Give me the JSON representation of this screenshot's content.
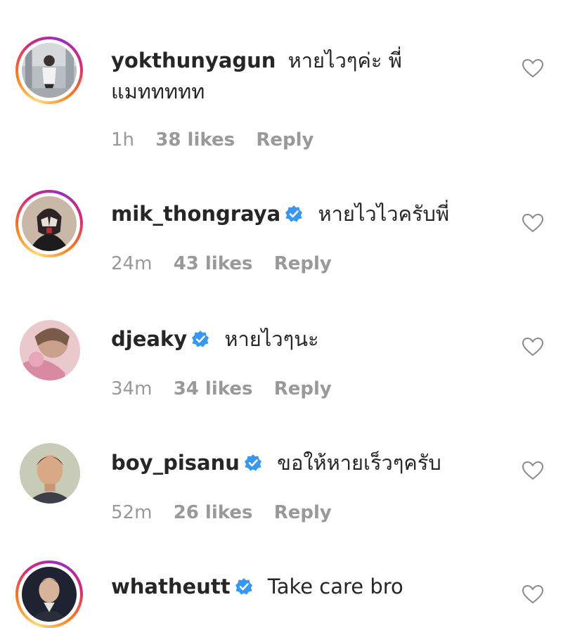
{
  "comments": [
    {
      "username": "yokthunyagun",
      "verified": false,
      "message": "หายไวๆค่ะ พี่แมททททท",
      "time": "1h",
      "likes": "38 likes",
      "reply": "Reply",
      "avatar_icon": "avatar-photo",
      "has_story_ring": true
    },
    {
      "username": "mik_thongraya",
      "verified": true,
      "message": "หายไวไวครับพี่",
      "time": "24m",
      "likes": "43 likes",
      "reply": "Reply",
      "avatar_icon": "avatar-photo",
      "has_story_ring": true
    },
    {
      "username": "djeaky",
      "verified": true,
      "message": "หายไวๆนะ",
      "time": "34m",
      "likes": "34 likes",
      "reply": "Reply",
      "avatar_icon": "avatar-photo",
      "has_story_ring": false
    },
    {
      "username": "boy_pisanu",
      "verified": true,
      "message": "ขอให้หายเร็วๆครับ",
      "time": "52m",
      "likes": "26 likes",
      "reply": "Reply",
      "avatar_icon": "avatar-photo",
      "has_story_ring": false
    },
    {
      "username": "whatheutt",
      "verified": true,
      "message": "Take care bro",
      "time": "",
      "likes": "",
      "reply": "",
      "avatar_icon": "avatar-photo",
      "has_story_ring": true
    }
  ],
  "colors": {
    "verified_badge": "#3897f0",
    "meta_text": "#999999",
    "username_text": "#262626"
  }
}
